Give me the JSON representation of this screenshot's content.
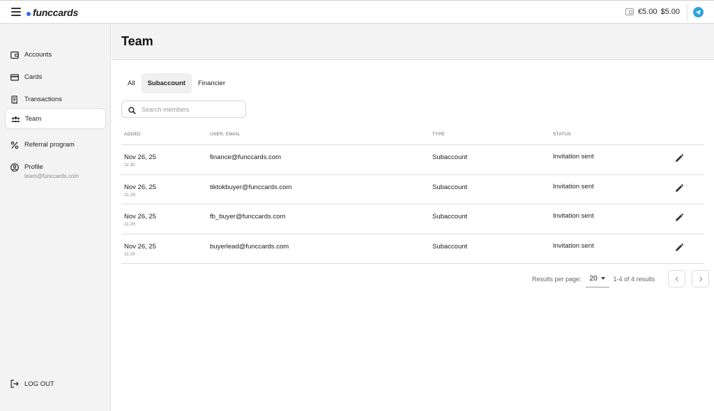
{
  "app": {
    "logo": "funccards",
    "accent_color": "#2f6fe4",
    "telegram_color": "#2aa3df"
  },
  "header": {
    "balance_eur": "€5.00",
    "balance_usd": "$5.00"
  },
  "sidebar": {
    "items": [
      {
        "label": "Accounts",
        "icon": "wallet-icon"
      },
      {
        "label": "Cards",
        "icon": "card-icon"
      },
      {
        "label": "Transactions",
        "icon": "receipt-icon"
      },
      {
        "label": "Team",
        "icon": "team-icon",
        "active": true
      },
      {
        "label": "Referral program",
        "icon": "percent-icon"
      },
      {
        "label": "Profile",
        "icon": "user-circle-icon",
        "sub": "team@funccards.com"
      }
    ],
    "logout_label": "LOG OUT"
  },
  "page": {
    "title": "Team"
  },
  "tabs": [
    {
      "label": "All",
      "active": false
    },
    {
      "label": "Subaccount",
      "active": true
    },
    {
      "label": "Financier",
      "active": false
    }
  ],
  "search": {
    "placeholder": "Search members",
    "value": ""
  },
  "table": {
    "columns": {
      "added": "ADDED",
      "user": "USER, EMAIL",
      "type": "TYPE",
      "status": "STATUS"
    },
    "rows": [
      {
        "date": "Nov 26, 25",
        "time": "11:30",
        "email": "finance@funccards.com",
        "type": "Subaccount",
        "status": "Invitation sent"
      },
      {
        "date": "Nov 26, 25",
        "time": "11:29",
        "email": "tiktokbuyer@funccards.com",
        "type": "Subaccount",
        "status": "Invitation sent"
      },
      {
        "date": "Nov 26, 25",
        "time": "11:29",
        "email": "fb_buyer@funccards.com",
        "type": "Subaccount",
        "status": "Invitation sent"
      },
      {
        "date": "Nov 26, 25",
        "time": "11:29",
        "email": "buyerlead@funccards.com",
        "type": "Subaccount",
        "status": "Invitation sent"
      }
    ]
  },
  "pagination": {
    "per_page_label": "Results per page:",
    "per_page": "20",
    "range": "1-4 of 4 results"
  }
}
